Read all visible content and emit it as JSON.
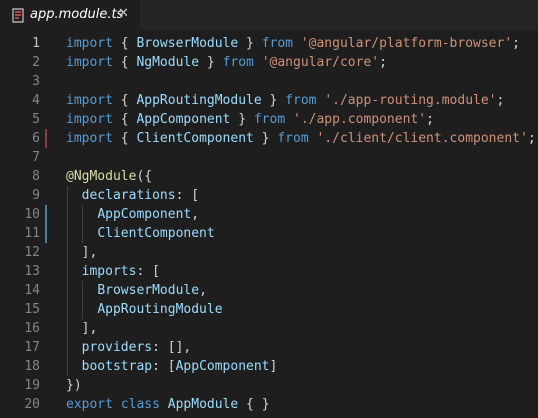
{
  "tab": {
    "title": "app.module.ts",
    "close_glyph": "✕",
    "icon": "typescript-file-icon"
  },
  "colors": {
    "background": "#1e1e1e",
    "tabbar": "#252526",
    "keyword": "#569cd6",
    "string": "#ce9178",
    "identifier": "#9cdcfe",
    "decorator": "#dcdcaa",
    "modified_marker": "#4d7ea8",
    "deleted_marker": "#8a3d3d"
  },
  "lines": [
    {
      "n": "1",
      "tokens": [
        [
          "kw",
          "import"
        ],
        [
          "punc",
          " { "
        ],
        [
          "ident",
          "BrowserModule"
        ],
        [
          "punc",
          " } "
        ],
        [
          "kw",
          "from"
        ],
        [
          "punc",
          " "
        ],
        [
          "str",
          "'@angular/platform-browser'"
        ],
        [
          "punc",
          ";"
        ]
      ]
    },
    {
      "n": "2",
      "tokens": [
        [
          "kw",
          "import"
        ],
        [
          "punc",
          " { "
        ],
        [
          "ident",
          "NgModule"
        ],
        [
          "punc",
          " } "
        ],
        [
          "kw",
          "from"
        ],
        [
          "punc",
          " "
        ],
        [
          "str",
          "'@angular/core'"
        ],
        [
          "punc",
          ";"
        ]
      ]
    },
    {
      "n": "3",
      "tokens": []
    },
    {
      "n": "4",
      "tokens": [
        [
          "kw",
          "import"
        ],
        [
          "punc",
          " { "
        ],
        [
          "ident",
          "AppRoutingModule"
        ],
        [
          "punc",
          " } "
        ],
        [
          "kw",
          "from"
        ],
        [
          "punc",
          " "
        ],
        [
          "str",
          "'./app-routing.module'"
        ],
        [
          "punc",
          ";"
        ]
      ]
    },
    {
      "n": "5",
      "tokens": [
        [
          "kw",
          "import"
        ],
        [
          "punc",
          " { "
        ],
        [
          "ident",
          "AppComponent"
        ],
        [
          "punc",
          " } "
        ],
        [
          "kw",
          "from"
        ],
        [
          "punc",
          " "
        ],
        [
          "str",
          "'./app.component'"
        ],
        [
          "punc",
          ";"
        ]
      ]
    },
    {
      "n": "6",
      "tokens": [
        [
          "kw",
          "import"
        ],
        [
          "punc",
          " { "
        ],
        [
          "ident",
          "ClientComponent"
        ],
        [
          "punc",
          " } "
        ],
        [
          "kw",
          "from"
        ],
        [
          "punc",
          " "
        ],
        [
          "str",
          "'./client/client.component'"
        ],
        [
          "punc",
          ";"
        ]
      ]
    },
    {
      "n": "7",
      "tokens": []
    },
    {
      "n": "8",
      "tokens": [
        [
          "dec",
          "@NgModule"
        ],
        [
          "punc",
          "({"
        ]
      ]
    },
    {
      "n": "9",
      "tokens": [
        [
          "punc",
          "  "
        ],
        [
          "ident",
          "declarations"
        ],
        [
          "punc",
          ": ["
        ]
      ]
    },
    {
      "n": "10",
      "tokens": [
        [
          "punc",
          "    "
        ],
        [
          "ident",
          "AppComponent"
        ],
        [
          "punc",
          ","
        ]
      ]
    },
    {
      "n": "11",
      "tokens": [
        [
          "punc",
          "    "
        ],
        [
          "ident",
          "ClientComponent"
        ]
      ]
    },
    {
      "n": "12",
      "tokens": [
        [
          "punc",
          "  ],"
        ]
      ]
    },
    {
      "n": "13",
      "tokens": [
        [
          "punc",
          "  "
        ],
        [
          "ident",
          "imports"
        ],
        [
          "punc",
          ": ["
        ]
      ]
    },
    {
      "n": "14",
      "tokens": [
        [
          "punc",
          "    "
        ],
        [
          "ident",
          "BrowserModule"
        ],
        [
          "punc",
          ","
        ]
      ]
    },
    {
      "n": "15",
      "tokens": [
        [
          "punc",
          "    "
        ],
        [
          "ident",
          "AppRoutingModule"
        ]
      ]
    },
    {
      "n": "16",
      "tokens": [
        [
          "punc",
          "  ],"
        ]
      ]
    },
    {
      "n": "17",
      "tokens": [
        [
          "punc",
          "  "
        ],
        [
          "ident",
          "providers"
        ],
        [
          "punc",
          ": [],"
        ]
      ]
    },
    {
      "n": "18",
      "tokens": [
        [
          "punc",
          "  "
        ],
        [
          "ident",
          "bootstrap"
        ],
        [
          "punc",
          ": ["
        ],
        [
          "ident",
          "AppComponent"
        ],
        [
          "punc",
          "]"
        ]
      ]
    },
    {
      "n": "19",
      "tokens": [
        [
          "punc",
          "})"
        ]
      ]
    },
    {
      "n": "20",
      "tokens": [
        [
          "kw",
          "export"
        ],
        [
          "punc",
          " "
        ],
        [
          "kw",
          "class"
        ],
        [
          "punc",
          " "
        ],
        [
          "ident",
          "AppModule"
        ],
        [
          "punc",
          " { }"
        ]
      ]
    }
  ],
  "active_line": "1",
  "modified_lines": [
    "10",
    "11"
  ],
  "changed_lines": [
    "6"
  ]
}
